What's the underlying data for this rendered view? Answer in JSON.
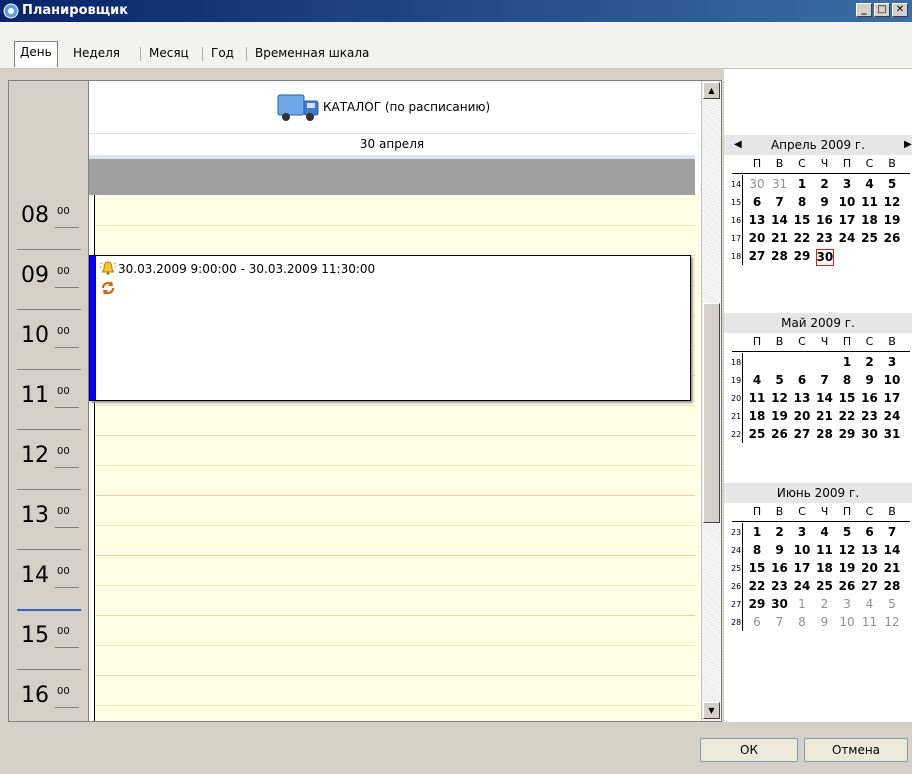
{
  "window": {
    "title": "Планировщик"
  },
  "tabs": [
    "День",
    "Неделя",
    "Месяц",
    "Год",
    "Временная шкала"
  ],
  "resource": {
    "name": "КАТАЛОГ (по расписанию)"
  },
  "day_header": {
    "date": "30 апреля"
  },
  "hours": [
    {
      "h": "08",
      "m": "00"
    },
    {
      "h": "09",
      "m": "00"
    },
    {
      "h": "10",
      "m": "00"
    },
    {
      "h": "11",
      "m": "00"
    },
    {
      "h": "12",
      "m": "00"
    },
    {
      "h": "13",
      "m": "00"
    },
    {
      "h": "14",
      "m": "00"
    },
    {
      "h": "15",
      "m": "00"
    },
    {
      "h": "16",
      "m": "00"
    }
  ],
  "event": {
    "text": "30.03.2009 9:00:00 - 30.03.2009 11:30:00"
  },
  "dow": [
    "П",
    "В",
    "С",
    "Ч",
    "П",
    "С",
    "В"
  ],
  "months": [
    {
      "title": "Апрель 2009 г.",
      "weeks": [
        {
          "n": "14",
          "days": [
            [
              "30",
              1
            ],
            [
              "31",
              1
            ],
            [
              "1",
              0
            ],
            [
              "2",
              0
            ],
            [
              "3",
              0
            ],
            [
              "4",
              0
            ],
            [
              "5",
              0
            ]
          ]
        },
        {
          "n": "15",
          "days": [
            [
              "6",
              0
            ],
            [
              "7",
              0
            ],
            [
              "8",
              0
            ],
            [
              "9",
              0
            ],
            [
              "10",
              0
            ],
            [
              "11",
              0
            ],
            [
              "12",
              0
            ]
          ]
        },
        {
          "n": "16",
          "days": [
            [
              "13",
              0
            ],
            [
              "14",
              0
            ],
            [
              "15",
              0
            ],
            [
              "16",
              0
            ],
            [
              "17",
              0
            ],
            [
              "18",
              0
            ],
            [
              "19",
              0
            ]
          ]
        },
        {
          "n": "17",
          "days": [
            [
              "20",
              0
            ],
            [
              "21",
              0
            ],
            [
              "22",
              0
            ],
            [
              "23",
              0
            ],
            [
              "24",
              0
            ],
            [
              "25",
              0
            ],
            [
              "26",
              0
            ]
          ]
        },
        {
          "n": "18",
          "days": [
            [
              "27",
              0
            ],
            [
              "28",
              0
            ],
            [
              "29",
              0
            ],
            [
              "30",
              2
            ]
          ]
        }
      ]
    },
    {
      "title": "Май 2009 г.",
      "weeks": [
        {
          "n": "18",
          "days": [
            [
              "",
              0
            ],
            [
              "",
              0
            ],
            [
              "",
              0
            ],
            [
              "",
              0
            ],
            [
              "",
              0
            ],
            [
              "1",
              0
            ],
            [
              "2",
              0
            ],
            [
              "3",
              0
            ]
          ]
        },
        {
          "n": "19",
          "days": [
            [
              "4",
              0
            ],
            [
              "5",
              0
            ],
            [
              "6",
              0
            ],
            [
              "7",
              0
            ],
            [
              "8",
              0
            ],
            [
              "9",
              0
            ],
            [
              "10",
              0
            ]
          ]
        },
        {
          "n": "20",
          "days": [
            [
              "11",
              0
            ],
            [
              "12",
              0
            ],
            [
              "13",
              0
            ],
            [
              "14",
              0
            ],
            [
              "15",
              0
            ],
            [
              "16",
              0
            ],
            [
              "17",
              0
            ]
          ]
        },
        {
          "n": "21",
          "days": [
            [
              "18",
              0
            ],
            [
              "19",
              0
            ],
            [
              "20",
              0
            ],
            [
              "21",
              0
            ],
            [
              "22",
              0
            ],
            [
              "23",
              0
            ],
            [
              "24",
              0
            ]
          ]
        },
        {
          "n": "22",
          "days": [
            [
              "25",
              0
            ],
            [
              "26",
              0
            ],
            [
              "27",
              0
            ],
            [
              "28",
              0
            ],
            [
              "29",
              0
            ],
            [
              "30",
              0
            ],
            [
              "31",
              0
            ]
          ]
        }
      ]
    },
    {
      "title": "Июнь 2009 г.",
      "weeks": [
        {
          "n": "23",
          "days": [
            [
              "1",
              0
            ],
            [
              "2",
              0
            ],
            [
              "3",
              0
            ],
            [
              "4",
              0
            ],
            [
              "5",
              0
            ],
            [
              "6",
              0
            ],
            [
              "7",
              0
            ]
          ]
        },
        {
          "n": "24",
          "days": [
            [
              "8",
              0
            ],
            [
              "9",
              0
            ],
            [
              "10",
              0
            ],
            [
              "11",
              0
            ],
            [
              "12",
              0
            ],
            [
              "13",
              0
            ],
            [
              "14",
              0
            ]
          ]
        },
        {
          "n": "25",
          "days": [
            [
              "15",
              0
            ],
            [
              "16",
              0
            ],
            [
              "17",
              0
            ],
            [
              "18",
              0
            ],
            [
              "19",
              0
            ],
            [
              "20",
              0
            ],
            [
              "21",
              0
            ]
          ]
        },
        {
          "n": "26",
          "days": [
            [
              "22",
              0
            ],
            [
              "23",
              0
            ],
            [
              "24",
              0
            ],
            [
              "25",
              0
            ],
            [
              "26",
              0
            ],
            [
              "27",
              0
            ],
            [
              "28",
              0
            ]
          ]
        },
        {
          "n": "27",
          "days": [
            [
              "29",
              0
            ],
            [
              "30",
              0
            ],
            [
              "1",
              1
            ],
            [
              "2",
              1
            ],
            [
              "3",
              1
            ],
            [
              "4",
              1
            ],
            [
              "5",
              1
            ]
          ]
        },
        {
          "n": "28",
          "days": [
            [
              "6",
              1
            ],
            [
              "7",
              1
            ],
            [
              "8",
              1
            ],
            [
              "9",
              1
            ],
            [
              "10",
              1
            ],
            [
              "11",
              1
            ],
            [
              "12",
              1
            ]
          ]
        }
      ]
    }
  ],
  "buttons": {
    "ok": "ОК",
    "cancel": "Отмена"
  },
  "colors": {
    "title_start": "#0a246a",
    "title_end": "#3a6ea5",
    "grid_bg": "#ffffe6",
    "event_bar": "#0000ff",
    "today_border": "#d02020"
  }
}
